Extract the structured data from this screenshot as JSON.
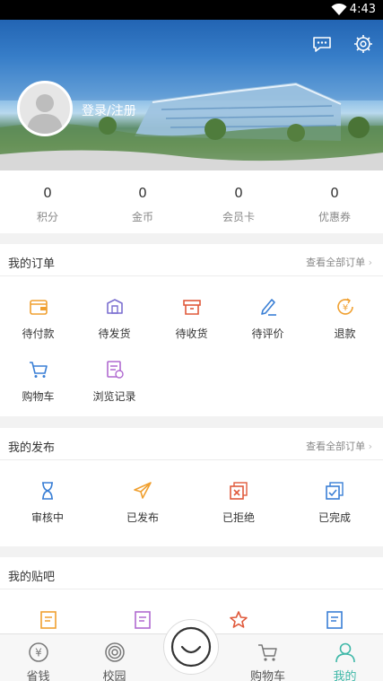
{
  "status_bar": {
    "time": "4:43"
  },
  "header": {
    "login_label": "登录/注册",
    "message_icon": "chat-bubble-icon",
    "settings_icon": "gear-icon"
  },
  "stats": [
    {
      "value": "0",
      "label": "积分"
    },
    {
      "value": "0",
      "label": "金币"
    },
    {
      "value": "0",
      "label": "会员卡"
    },
    {
      "value": "0",
      "label": "优惠券"
    }
  ],
  "orders": {
    "title": "我的订单",
    "more": "查看全部订单",
    "items": [
      {
        "label": "待付款",
        "icon": "wallet-icon"
      },
      {
        "label": "待发货",
        "icon": "package-icon"
      },
      {
        "label": "待收货",
        "icon": "box-icon"
      },
      {
        "label": "待评价",
        "icon": "pen-icon"
      },
      {
        "label": "退款",
        "icon": "yuan-refund-icon"
      },
      {
        "label": "购物车",
        "icon": "cart-icon"
      },
      {
        "label": "浏览记录",
        "icon": "history-doc-icon"
      }
    ]
  },
  "publish": {
    "title": "我的发布",
    "more": "查看全部订单",
    "items": [
      {
        "label": "审核中",
        "icon": "hourglass-icon"
      },
      {
        "label": "已发布",
        "icon": "paper-plane-icon"
      },
      {
        "label": "已拒绝",
        "icon": "reject-doc-icon"
      },
      {
        "label": "已完成",
        "icon": "check-doc-icon"
      }
    ]
  },
  "tieba": {
    "title": "我的贴吧",
    "items": [
      {
        "icon": "doc-orange-icon"
      },
      {
        "icon": "doc-purple-icon"
      },
      {
        "icon": "star-icon"
      },
      {
        "icon": "doc-blue-icon"
      }
    ]
  },
  "tabbar": {
    "items": [
      {
        "label": "省钱",
        "icon": "yuan-coin-icon"
      },
      {
        "label": "校园",
        "icon": "spiral-icon"
      },
      {
        "label": "",
        "icon": "smile-center-icon"
      },
      {
        "label": "购物车",
        "icon": "cart-icon"
      },
      {
        "label": "我的",
        "icon": "person-icon"
      }
    ]
  },
  "colors": {
    "accent": "#3fb8a8",
    "orange": "#f0a030",
    "purple": "#7b6fd0",
    "red": "#e05a3c",
    "blue": "#3a7fd5"
  }
}
